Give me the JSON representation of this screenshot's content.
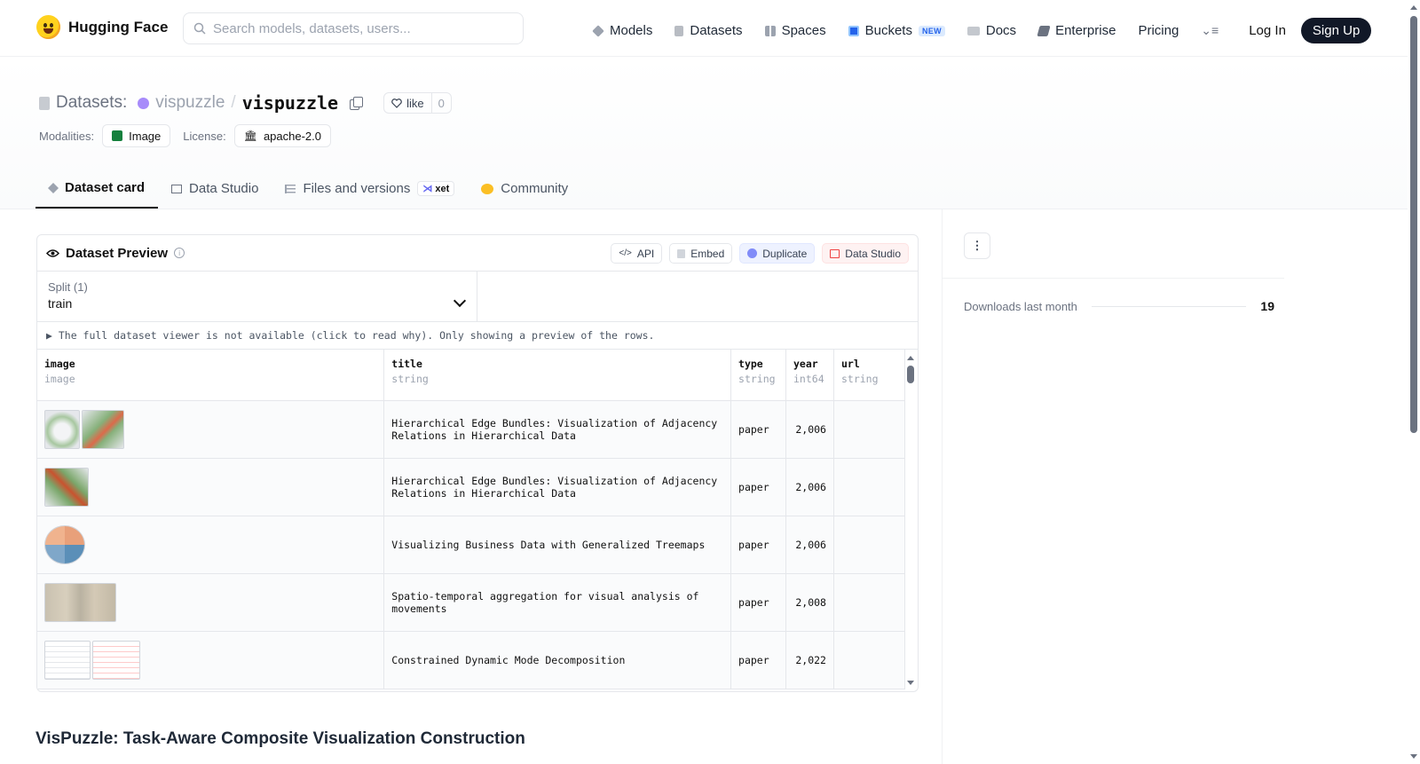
{
  "nav": {
    "brand": "Hugging Face",
    "search_placeholder": "Search models, datasets, users...",
    "links": [
      {
        "label": "Models",
        "icon": "cube-icon",
        "color": "#9ca3af"
      },
      {
        "label": "Datasets",
        "icon": "database-icon",
        "color": "#9ca3af"
      },
      {
        "label": "Spaces",
        "icon": "grid-icon",
        "color": "#9ca3af"
      },
      {
        "label": "Buckets",
        "icon": "bucket-icon",
        "color": "#2563eb",
        "badge": "NEW"
      },
      {
        "label": "Docs",
        "icon": "book-icon",
        "color": "#9ca3af"
      },
      {
        "label": "Enterprise",
        "icon": "enterprise-icon",
        "color": "#6b7280"
      },
      {
        "label": "Pricing"
      }
    ],
    "login": "Log In",
    "signup": "Sign Up"
  },
  "header": {
    "section": "Datasets:",
    "owner": "vispuzzle",
    "separator": "/",
    "repo": "vispuzzle",
    "like_label": "like",
    "like_count": "0",
    "modalities_label": "Modalities:",
    "modality": "Image",
    "license_label": "License:",
    "license": "apache-2.0"
  },
  "tabs": [
    {
      "label": "Dataset card",
      "active": true
    },
    {
      "label": "Data Studio"
    },
    {
      "label": "Files and versions",
      "badge": "xet"
    },
    {
      "label": "Community"
    }
  ],
  "preview": {
    "title": "Dataset Preview",
    "actions": [
      "API",
      "Embed",
      "Duplicate",
      "Data Studio"
    ],
    "split_label": "Split (1)",
    "split_value": "train",
    "notice": "▶ The full dataset viewer is not available (click to read why). Only showing a preview of the rows.",
    "columns": [
      {
        "name": "image",
        "type": "image"
      },
      {
        "name": "title",
        "type": "string"
      },
      {
        "name": "type",
        "type": "string"
      },
      {
        "name": "year",
        "type": "int64"
      },
      {
        "name": "url",
        "type": "string"
      }
    ],
    "rows": [
      {
        "title": "Hierarchical Edge Bundles: Visualization of Adjacency Relations in Hierarchical Data",
        "type": "paper",
        "year": "2,006",
        "url": ""
      },
      {
        "title": "Hierarchical Edge Bundles: Visualization of Adjacency Relations in Hierarchical Data",
        "type": "paper",
        "year": "2,006",
        "url": ""
      },
      {
        "title": "Visualizing Business Data with Generalized Treemaps",
        "type": "paper",
        "year": "2,006",
        "url": ""
      },
      {
        "title": "Spatio-temporal aggregation for visual analysis of movements",
        "type": "paper",
        "year": "2,008",
        "url": ""
      },
      {
        "title": "Constrained Dynamic Mode Decomposition",
        "type": "paper",
        "year": "2,022",
        "url": ""
      }
    ]
  },
  "section_title": "VisPuzzle: Task-Aware Composite Visualization Construction",
  "sidebar": {
    "downloads_label": "Downloads last month",
    "downloads_value": "19"
  }
}
